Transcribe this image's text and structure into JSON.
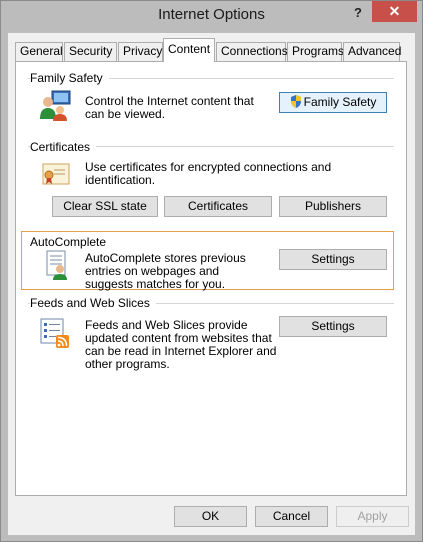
{
  "window": {
    "title": "Internet Options",
    "help_label": "?",
    "close_label": "✕"
  },
  "tabs": [
    {
      "label": "General"
    },
    {
      "label": "Security"
    },
    {
      "label": "Privacy"
    },
    {
      "label": "Content",
      "selected": true
    },
    {
      "label": "Connections"
    },
    {
      "label": "Programs"
    },
    {
      "label": "Advanced"
    }
  ],
  "family_safety": {
    "heading": "Family Safety",
    "description": "Control the Internet content that can be viewed.",
    "button_label": "Family Safety",
    "icon": "family-safety-icon"
  },
  "certificates": {
    "heading": "Certificates",
    "description": "Use certificates for encrypted connections and identification.",
    "buttons": [
      "Clear SSL state",
      "Certificates",
      "Publishers"
    ],
    "icon": "certificate-icon"
  },
  "autocomplete": {
    "heading": "AutoComplete",
    "description": "AutoComplete stores previous entries on webpages and suggests matches for you.",
    "button_label": "Settings",
    "icon": "autocomplete-icon"
  },
  "feeds": {
    "heading": "Feeds and Web Slices",
    "description": "Feeds and Web Slices provide updated content from websites that can be read in Internet Explorer and other programs.",
    "button_label": "Settings",
    "icon": "feeds-icon"
  },
  "footer": {
    "ok_label": "OK",
    "cancel_label": "Cancel",
    "apply_label": "Apply"
  },
  "colors": {
    "accent_focus": "#3c7fb1",
    "group_highlight": "#e3a14b",
    "close_button": "#c7504a"
  }
}
